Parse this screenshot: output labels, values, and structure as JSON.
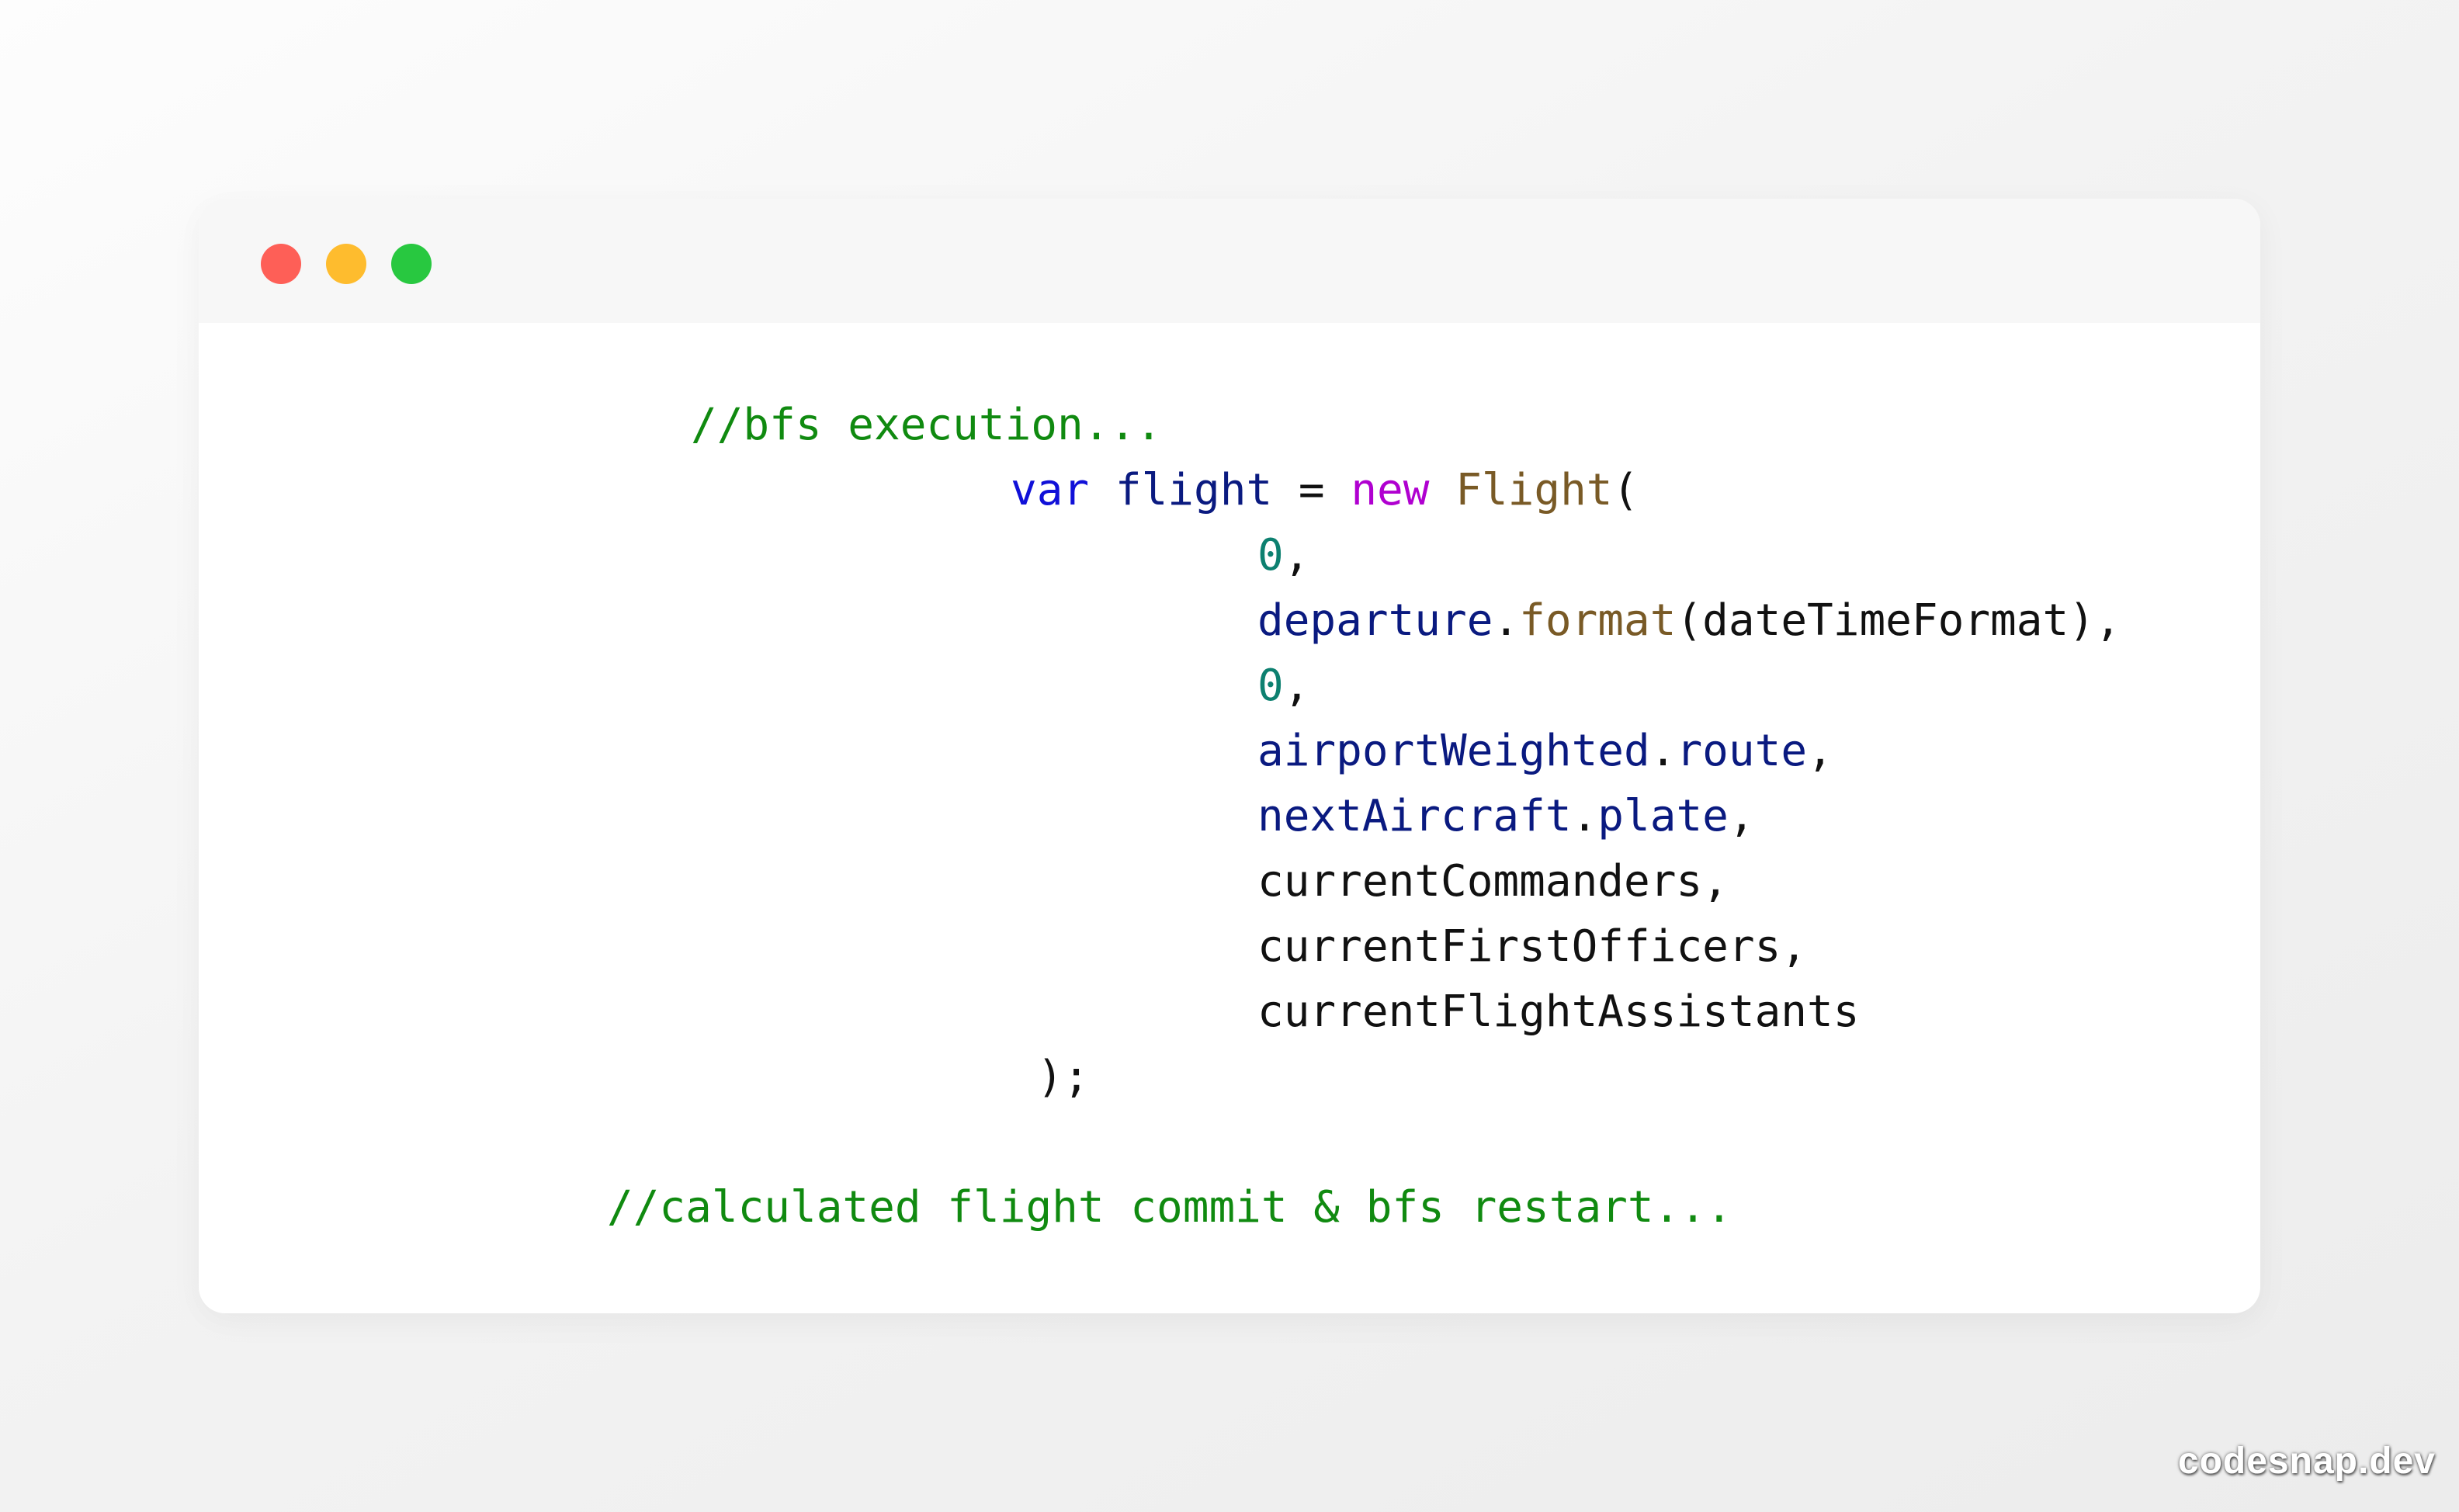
{
  "window": {
    "controls": [
      "close",
      "minimize",
      "maximize"
    ]
  },
  "code": {
    "lines": [
      [
        {
          "t": "//bfs execution...",
          "k": "comment"
        }
      ],
      [
        {
          "t": "var",
          "k": "kw"
        },
        {
          "t": " ",
          "k": "plain"
        },
        {
          "t": "flight",
          "k": "var"
        },
        {
          "t": " = ",
          "k": "plain"
        },
        {
          "t": "new",
          "k": "new"
        },
        {
          "t": " ",
          "k": "plain"
        },
        {
          "t": "Flight",
          "k": "class"
        },
        {
          "t": "(",
          "k": "plain"
        }
      ],
      [
        {
          "t": "0",
          "k": "num"
        },
        {
          "t": ",",
          "k": "plain"
        }
      ],
      [
        {
          "t": "departure",
          "k": "var"
        },
        {
          "t": ".",
          "k": "plain"
        },
        {
          "t": "format",
          "k": "fn"
        },
        {
          "t": "(dateTimeFormat),",
          "k": "plain"
        }
      ],
      [
        {
          "t": "0",
          "k": "num"
        },
        {
          "t": ",",
          "k": "plain"
        }
      ],
      [
        {
          "t": "airportWeighted",
          "k": "var"
        },
        {
          "t": ".",
          "k": "plain"
        },
        {
          "t": "route",
          "k": "var"
        },
        {
          "t": ",",
          "k": "plain"
        }
      ],
      [
        {
          "t": "nextAircraft",
          "k": "var"
        },
        {
          "t": ".",
          "k": "plain"
        },
        {
          "t": "plate",
          "k": "var"
        },
        {
          "t": ",",
          "k": "plain"
        }
      ],
      [
        {
          "t": "currentCommanders,",
          "k": "plain"
        }
      ],
      [
        {
          "t": "currentFirstOfficers,",
          "k": "plain"
        }
      ],
      [
        {
          "t": "currentFlightAssistants",
          "k": "plain"
        }
      ],
      [
        {
          "t": ");",
          "k": "plain"
        }
      ],
      [
        {
          "t": "//calculated flight commit & bfs restart...",
          "k": "comment"
        }
      ]
    ]
  },
  "colors": {
    "comment": "#108a10",
    "keyword": "#1010d8",
    "new_keyword": "#b000d0",
    "class": "#795a26",
    "number": "#0d8070",
    "variable": "#0a1a80",
    "plain": "#111111",
    "close_dot": "#fe5f57",
    "minimize_dot": "#febc2e",
    "maximize_dot": "#28c840"
  },
  "watermark": "codesnap.dev"
}
